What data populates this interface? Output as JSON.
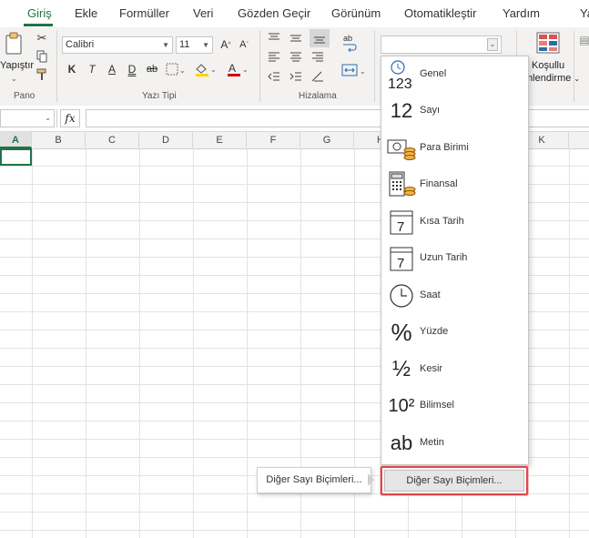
{
  "tabs": [
    "Giriş",
    "Ekle",
    "Formüller",
    "Veri",
    "Gözden Geçir",
    "Görünüm",
    "Otomatikleştir",
    "Yardım",
    "Ya"
  ],
  "ribbon": {
    "clipboard": {
      "paste_label": "Yapıştır",
      "group_label": "Pano"
    },
    "font": {
      "name": "Calibri",
      "size": "11",
      "bold": "K",
      "italic": "T",
      "underline": "A",
      "strike": "ab",
      "group_label": "Yazı Tipi"
    },
    "alignment": {
      "group_label": "Hizalama"
    },
    "conditional": {
      "label_line1": "Koşullu",
      "label_line2": "mlendirme"
    }
  },
  "formula_bar": {
    "fx": "fx"
  },
  "columns": [
    "A",
    "B",
    "C",
    "D",
    "E",
    "F",
    "G",
    "H",
    "K"
  ],
  "number_formats": [
    {
      "label": "Genel",
      "icon": "123"
    },
    {
      "label": "Sayı",
      "icon": "12"
    },
    {
      "label": "Para Birimi",
      "icon": "currency-icon"
    },
    {
      "label": "Finansal",
      "icon": "calculator-icon"
    },
    {
      "label": "Kısa Tarih",
      "icon": "7"
    },
    {
      "label": "Uzun Tarih",
      "icon": "7"
    },
    {
      "label": "Saat",
      "icon": "clock-icon"
    },
    {
      "label": "Yüzde",
      "icon": "%"
    },
    {
      "label": "Kesir",
      "icon": "½"
    },
    {
      "label": "Bilimsel",
      "icon": "10²"
    },
    {
      "label": "Metin",
      "icon": "ab"
    }
  ],
  "more_formats_label": "Diğer Sayı Biçimleri...",
  "tooltip_label": "Diğer Sayı Biçimleri...",
  "colors": {
    "accent": "#217346",
    "highlight_border": "#e0474c"
  }
}
